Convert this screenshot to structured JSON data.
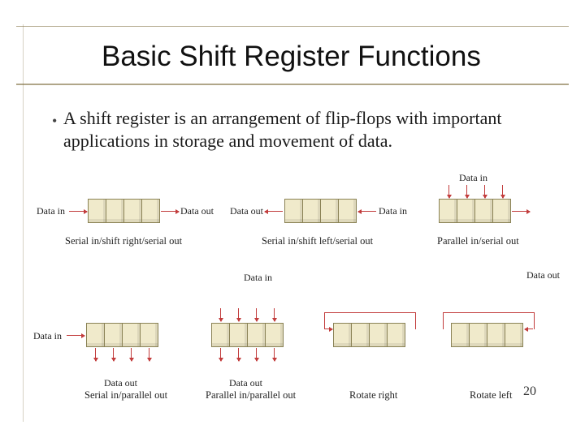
{
  "title": "Basic Shift Register Functions",
  "bullet": "A shift register is an arrangement of  flip-flops with important applications in storage and movement of data.",
  "labels": {
    "data_in": "Data in",
    "data_out": "Data out"
  },
  "captions": {
    "siso_right": "Serial in/shift right/serial out",
    "siso_left": "Serial in/shift left/serial out",
    "piso": "Parallel in/serial out",
    "sipo": "Serial in/parallel out",
    "pipo": "Parallel in/parallel out",
    "rot_r": "Rotate right",
    "rot_l": "Rotate left"
  },
  "page": "20"
}
